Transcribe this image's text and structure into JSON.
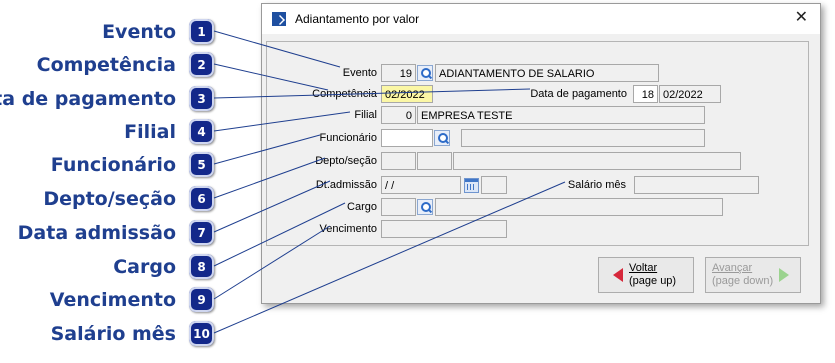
{
  "callouts": [
    {
      "num": "1",
      "label": "Evento"
    },
    {
      "num": "2",
      "label": "Competência"
    },
    {
      "num": "3",
      "label": "Data de pagamento"
    },
    {
      "num": "4",
      "label": "Filial"
    },
    {
      "num": "5",
      "label": "Funcionário"
    },
    {
      "num": "6",
      "label": "Depto/seção"
    },
    {
      "num": "7",
      "label": "Data admissão"
    },
    {
      "num": "8",
      "label": "Cargo"
    },
    {
      "num": "9",
      "label": "Vencimento"
    },
    {
      "num": "10",
      "label": "Salário mês"
    }
  ],
  "window": {
    "title": "Adiantamento por valor",
    "close": "✕"
  },
  "form": {
    "evento_label": "Evento",
    "evento_code": "19",
    "evento_desc": "ADIANTAMENTO DE SALARIO",
    "competencia_label": "Competência",
    "competencia_value": "02/2022",
    "data_pagamento_label": "Data de pagamento",
    "data_pagamento_day": "18",
    "data_pagamento_month": "02/2022",
    "filial_label": "Filial",
    "filial_code": "0",
    "filial_name": "EMPRESA TESTE",
    "funcionario_label": "Funcionário",
    "funcionario_value": "",
    "funcionario_name": "",
    "depto_label": "Depto/seção",
    "dt_admissao_label": "Dt.admissão",
    "dt_admissao_value": " /  /",
    "salario_mes_label": "Salário mês",
    "salario_mes_value": "",
    "cargo_label": "Cargo",
    "vencimento_label": "Vencimento"
  },
  "buttons": {
    "voltar_line1": "Voltar",
    "voltar_line2": "(page up)",
    "avancar_line1": "Avançar",
    "avancar_line2": "(page down)"
  }
}
